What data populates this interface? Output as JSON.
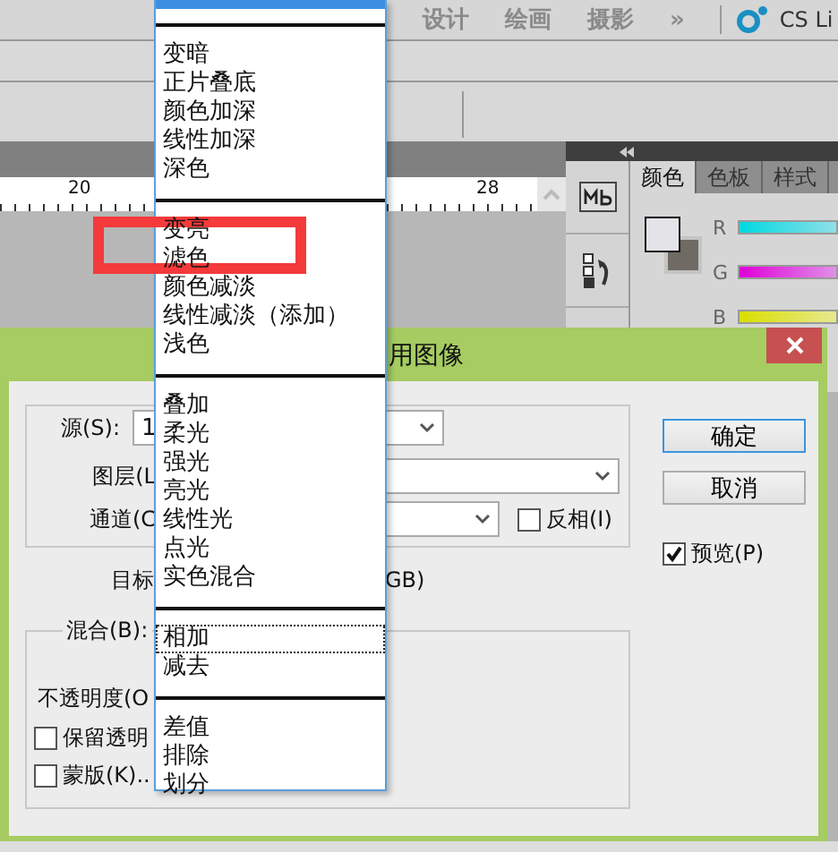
{
  "app_menu": [
    "设计",
    "绘画",
    "摄影",
    "»"
  ],
  "workspace_label": "CS Li",
  "ruler": {
    "labels": [
      "20",
      "28"
    ]
  },
  "panel": {
    "tabs": [
      {
        "label": "颜色",
        "selected": true
      },
      {
        "label": "色板",
        "selected": false
      },
      {
        "label": "样式",
        "selected": false
      }
    ],
    "channels": [
      "R",
      "G",
      "B"
    ]
  },
  "dialog": {
    "title": "用图像",
    "source": {
      "label": "源(S):",
      "value": "1"
    },
    "layer": {
      "label": "图层(L"
    },
    "channel": {
      "label": "通道(C"
    },
    "invert": {
      "label": "反相(I)",
      "checked": false
    },
    "target": {
      "label": "目标",
      "value_tail": "GB)"
    },
    "blending": {
      "label": "混合(B):",
      "opacity_label": "不透明度(O",
      "preserve": {
        "label": "保留透明",
        "checked": false
      },
      "mask": {
        "label": "蒙版(K)..",
        "checked": false
      }
    },
    "buttons": [
      "确定",
      "取消"
    ],
    "preview": {
      "label": "预览(P)",
      "checked": true
    }
  },
  "blend_menu": {
    "top_item_selected": true,
    "groups": [
      [
        {
          "label": "变暗",
          "focused": false
        },
        {
          "label": "正片叠底",
          "focused": false
        },
        {
          "label": "颜色加深",
          "focused": false
        },
        {
          "label": "线性加深",
          "focused": false
        },
        {
          "label": "深色",
          "focused": false
        }
      ],
      [
        {
          "label": "变亮",
          "focused": false
        },
        {
          "label": "滤色",
          "focused": false
        },
        {
          "label": "颜色减淡",
          "focused": false
        },
        {
          "label": "线性减淡（添加）",
          "focused": false
        },
        {
          "label": "浅色",
          "focused": false
        }
      ],
      [
        {
          "label": "叠加",
          "focused": false
        },
        {
          "label": "柔光",
          "focused": false
        },
        {
          "label": "强光",
          "focused": false
        },
        {
          "label": "亮光",
          "focused": false
        },
        {
          "label": "线性光",
          "focused": false
        },
        {
          "label": "点光",
          "focused": false
        },
        {
          "label": "实色混合",
          "focused": false
        }
      ],
      [
        {
          "label": "相加",
          "focused": true
        },
        {
          "label": "减去",
          "focused": false
        }
      ],
      [
        {
          "label": "差值",
          "focused": false
        },
        {
          "label": "排除",
          "focused": false
        },
        {
          "label": "划分",
          "focused": false
        }
      ]
    ]
  }
}
